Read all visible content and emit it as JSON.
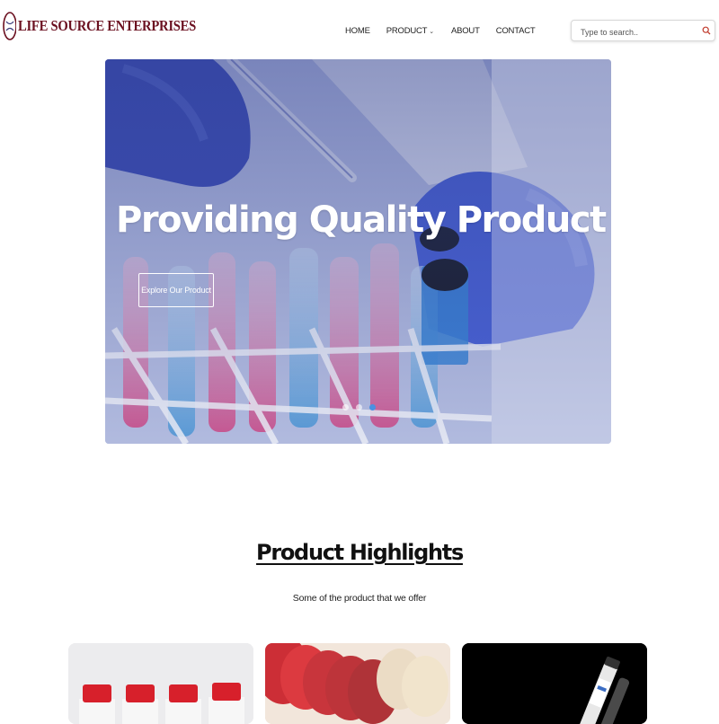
{
  "brand": {
    "name": "LIFE SOURCE ENTERPRISES",
    "colors": {
      "brand": "#6b1020",
      "accent": "#4a90e2"
    }
  },
  "nav": {
    "items": [
      {
        "label": "HOME"
      },
      {
        "label": "PRODUCT",
        "has_dropdown": true,
        "icon": "chevron-down-icon"
      },
      {
        "label": "ABOUT"
      },
      {
        "label": "CONTACT"
      }
    ]
  },
  "search": {
    "placeholder": "Type to search..",
    "value": "",
    "icon": "search-icon"
  },
  "hero": {
    "title": "Providing Quality Product",
    "button_label": "Explore Our Product",
    "slides_total": 3,
    "active_slide": 3
  },
  "highlights": {
    "title": "Product Highlights",
    "subtitle": "Some of the product that we offer",
    "cards": [
      {
        "image": "white bottles with red caps"
      },
      {
        "image": "petri dishes with red agar"
      },
      {
        "image": "test tubes on black background"
      }
    ]
  }
}
